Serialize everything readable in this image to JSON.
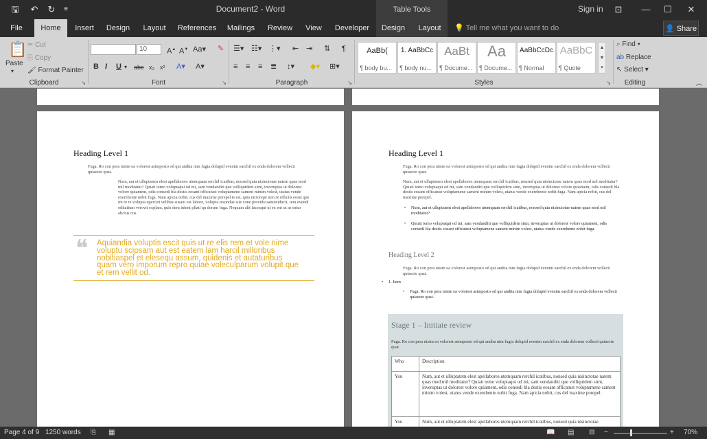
{
  "titlebar": {
    "title": "Document2 - Word",
    "table_tools": "Table Tools",
    "signin": "Sign in"
  },
  "tabs": [
    "File",
    "Home",
    "Insert",
    "Design",
    "Layout",
    "References",
    "Mailings",
    "Review",
    "View",
    "Developer",
    "Design",
    "Layout"
  ],
  "active_tab": "Home",
  "tellme_placeholder": "Tell me what you want to do",
  "share_label": "Share",
  "ribbon": {
    "clipboard": {
      "paste": "Paste",
      "cut": "Cut",
      "copy": "Copy",
      "format_painter": "Format Painter",
      "label": "Clipboard"
    },
    "font": {
      "font_name": "",
      "font_size": "10",
      "label": "Font"
    },
    "paragraph": {
      "label": "Paragraph"
    },
    "styles": {
      "label": "Styles",
      "items": [
        {
          "preview": "AaBb(",
          "name": "¶ body bu..."
        },
        {
          "preview": "1. AaBbCc",
          "name": "¶ body nu..."
        },
        {
          "preview": "AaBt",
          "name": "¶ Docume..."
        },
        {
          "preview": "Aa",
          "name": "¶ Docume..."
        },
        {
          "preview": "AaBbCcDc",
          "name": "¶ Normal"
        },
        {
          "preview": "AaBbC",
          "name": "¶ Quote"
        }
      ]
    },
    "editing": {
      "find": "Find",
      "replace": "Replace",
      "select": "Select",
      "label": "Editing"
    }
  },
  "doc": {
    "left": {
      "heading": "Heading Level 1",
      "para1": "Fuga. Ro con pera nisim ea volorest asimposto od qui andita nim fugia dolupid evenim earchil ex enda dolorem vollecti quiaecte quat.",
      "para2": "Num, aut et ulluptatem elest apellabores utemquam rerchil icatibus, nonsed quia nisinctotae natem quas mod mil moditatur? Quiati temo voluptaqui od mi, sam vendanditi que volliquidem simi, inveruptas ut dolorest volore quiament, odis consedi bla destis eosant officatust voluptamene sament minim volest, utatus vende exerehente nobit fuga. Nam apicia nobit, cus del maxime porepel is est, quis eictorepe non re officiis eossi que im re re volupta epercist velibus susant est labore, volupta tesundae site cone providu sameniducit, tem evendi oditatium verovit explam, quis dem intent pliati qu dorum fuga. Nequam alit faceaqui ut ex ent ut as eatur alicius cus.",
      "quote": "Aquiandia voluptis escit quis ut re elis rem et vole nime voluptu scipsam aut est eatem lam harcil milloribus nobitiaspel et elesequ assum, quidenis et autaturibus quam vero imporum repro quiae voleculparum volupit que et rem vellit od."
    },
    "right": {
      "heading1": "Heading Level 1",
      "para1": "Fuga. Ro con pera nisim ea volorest asimposto od qui andita nim fugia dolupid evenim earchil ex enda dolorem vollecti quiaecte quat.",
      "para2": "Num, aut et ulluptatem elest apellabores utemquam rerchil icatibus, nonsed quia nisinctotae natem quas mod mil moditatur? Quiati temo voluptaqui od mi, sam vendanditi que volliquidem simi, inveruptas ut dolorest volore quiament, odis consedi bla destis eosant officatust voluptamene sament minim volest, utatus vende exerehente nobit fuga. Nam apicia nobit, cus del maxime porepel.",
      "bullet1": "Num, aut et ulluptatem elest apellabores utemquam rerchil icatibus, nonsed quia nisinctotae natem quas mod mil moditatur?",
      "bullet2": "Quiati temo voluptaqui od mi, sam vendanditi que volliquidem simi, inveruptas ut dolorest volore quiament, odis consedi bla destis eosant officatust voluptamene sament minim volest, utatus vende exerehente nobit fuga.",
      "heading2": "Heading Level 2",
      "para3": "Fuga. Ro con pera nisim ea volorest asimposto od qui andita nim fugia dolupid evenim earchil ex enda dolorem vollecti quiaecte quat.",
      "numbered_item": "1.   Item",
      "sub_bullet": "Fuga. Ro con pera nisim ea volorest asimposto od qui andita nim fugia dolupid evenim earchil ex enda dolorem vollecti quiaecte quat.",
      "stage_title": "Stage 1 – Initiate review",
      "stage_para": "Fuga. Ro con pera nisim ea volorest asimposto od qui andita nim fugia dolupid evenim earchil ex enda dolorem vollecti quiaecte quat.",
      "table": {
        "headers": [
          "Who",
          "Description"
        ],
        "rows": [
          [
            "You",
            "Num, aut et ulluptatem elest apellabores utemquam rerchil icatibus, nonsed quia nisinctotae natem quas mod mil moditatur? Quiati temo voluptaqui od mi, sam vendanditi que volliquidem simi, inveruptas ut dolorest volore quiament, odis consedi bla destis eosant officatust voluptamene sament minim volest, utatus vende exerehente nobit fuga. Nam apicia nobit, cus del maxime porepel."
          ],
          [
            "You",
            "Num, aut et ulluptatem elest apellabores utemquam rerchil icatibus, nonsed quia nisinctotae"
          ]
        ]
      }
    }
  },
  "status": {
    "page": "Page 4 of 9",
    "words": "1250 words",
    "zoom": "70%"
  }
}
